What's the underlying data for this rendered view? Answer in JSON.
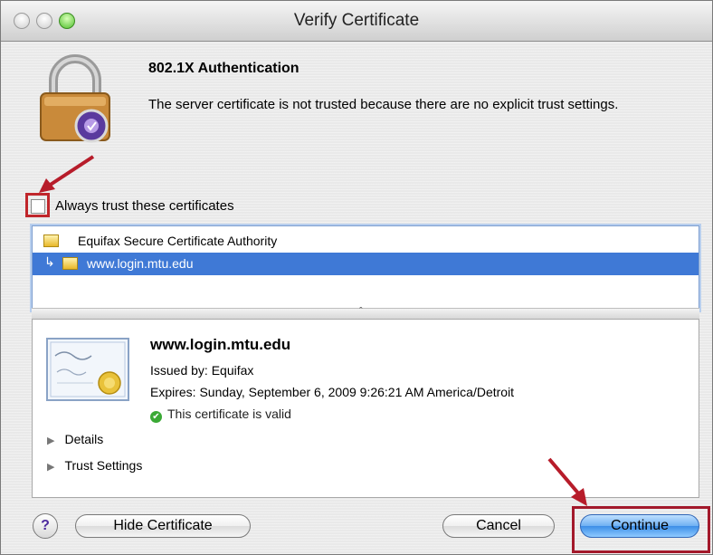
{
  "window": {
    "title": "Verify Certificate"
  },
  "header": {
    "heading": "802.1X Authentication",
    "message": "The server certificate is not trusted because there are no explicit trust settings."
  },
  "trust_checkbox": {
    "label": "Always trust these certificates",
    "checked": false
  },
  "certificate_chain": [
    {
      "name": "Equifax Secure Certificate Authority",
      "selected": false
    },
    {
      "name": "www.login.mtu.edu",
      "selected": true
    }
  ],
  "details": {
    "name": "www.login.mtu.edu",
    "issued_by": "Issued by: Equifax",
    "expires": "Expires: Sunday, September 6, 2009 9:26:21 AM America/Detroit",
    "status": "This certificate is valid",
    "disclosure_details": "Details",
    "disclosure_trust": "Trust Settings"
  },
  "buttons": {
    "help": "?",
    "hide_certificate": "Hide Certificate",
    "cancel": "Cancel",
    "continue": "Continue"
  },
  "colors": {
    "selection": "#3f79d6",
    "annotation_red": "#c0262b",
    "valid_green": "#3aa935",
    "default_button": "#3d8ee8"
  },
  "icons": {
    "lock": "padlock-icon",
    "certificate": "certificate-icon",
    "valid": "checkmark-circle-icon",
    "help": "help-icon"
  }
}
